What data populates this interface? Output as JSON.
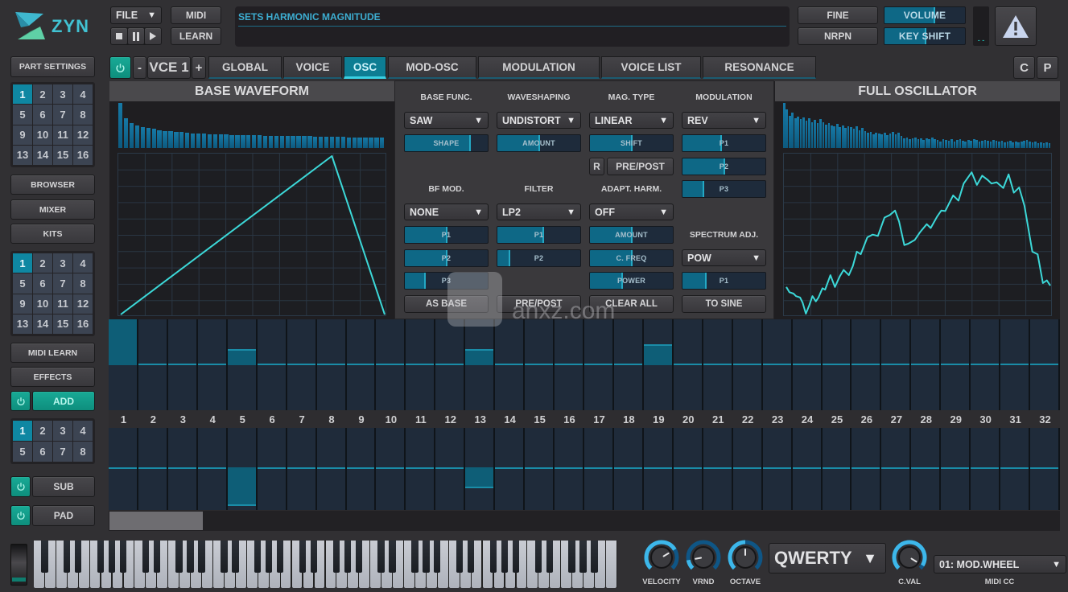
{
  "logo": {
    "text": "ZYN"
  },
  "header": {
    "file_label": "FILE",
    "midi_label": "MIDI",
    "learn_label": "LEARN",
    "status_text": "SETS HARMONIC MAGNITUDE",
    "fine_label": "FINE",
    "nrpn_label": "NRPN",
    "volume": {
      "label": "VOLUME",
      "value": 0.63
    },
    "key_shift": {
      "label": "KEY SHIFT",
      "value": 0.52
    },
    "meter_text": "- -"
  },
  "sidebar": {
    "part_settings_label": "PART SETTINGS",
    "part_grid": {
      "cells": [
        "1",
        "2",
        "3",
        "4",
        "5",
        "6",
        "7",
        "8",
        "9",
        "10",
        "11",
        "12",
        "13",
        "14",
        "15",
        "16"
      ],
      "active_index": 0
    },
    "browser_label": "BROWSER",
    "mixer_label": "MIXER",
    "kits_label": "KITS",
    "kit_grid": {
      "cells": [
        "1",
        "2",
        "3",
        "4",
        "5",
        "6",
        "7",
        "8",
        "9",
        "10",
        "11",
        "12",
        "13",
        "14",
        "15",
        "16"
      ],
      "active_index": 0
    },
    "midi_learn_label": "MIDI LEARN",
    "effects_label": "EFFECTS",
    "add_label": "ADD",
    "voice_grid": {
      "cells": [
        "1",
        "2",
        "3",
        "4",
        "5",
        "6",
        "7",
        "8"
      ],
      "active_index": 0
    },
    "sub_label": "SUB",
    "pad_label": "PAD"
  },
  "voice_selector": {
    "minus": "-",
    "label": "VCE 1",
    "plus": "+"
  },
  "tabs": {
    "active_index": 2,
    "items": [
      {
        "label": "GLOBAL"
      },
      {
        "label": "VOICE"
      },
      {
        "label": "OSC"
      },
      {
        "label": "MOD-OSC"
      },
      {
        "label": "MODULATION"
      },
      {
        "label": "VOICE LIST"
      },
      {
        "label": "RESONANCE"
      }
    ]
  },
  "corner_buttons": {
    "c": "C",
    "p": "P"
  },
  "base_waveform": {
    "title": "BASE WAVEFORM",
    "spectrum": [
      1.0,
      0.66,
      0.56,
      0.5,
      0.47,
      0.44,
      0.42,
      0.4,
      0.38,
      0.37,
      0.36,
      0.35,
      0.34,
      0.33,
      0.32,
      0.32,
      0.31,
      0.31,
      0.3,
      0.3,
      0.29,
      0.29,
      0.29,
      0.28,
      0.28,
      0.28,
      0.27,
      0.27,
      0.27,
      0.27,
      0.26,
      0.26,
      0.26,
      0.26,
      0.26,
      0.25,
      0.25,
      0.25,
      0.25,
      0.25,
      0.25,
      0.24,
      0.24,
      0.24,
      0.24,
      0.24,
      0.24,
      0.24
    ],
    "points": [
      [
        0,
        -1
      ],
      [
        0.8,
        1
      ],
      [
        1,
        -1
      ]
    ]
  },
  "full_oscillator": {
    "title": "FULL OSCILLATOR",
    "spectrum": [
      1.0,
      0.86,
      0.72,
      0.78,
      0.66,
      0.7,
      0.64,
      0.68,
      0.6,
      0.66,
      0.58,
      0.62,
      0.56,
      0.64,
      0.58,
      0.52,
      0.56,
      0.5,
      0.48,
      0.54,
      0.46,
      0.5,
      0.44,
      0.48,
      0.46,
      0.42,
      0.48,
      0.4,
      0.44,
      0.38,
      0.34,
      0.36,
      0.3,
      0.34,
      0.32,
      0.3,
      0.34,
      0.28,
      0.32,
      0.36,
      0.3,
      0.34,
      0.26,
      0.22,
      0.24,
      0.2,
      0.22,
      0.24,
      0.2,
      0.22,
      0.18,
      0.22,
      0.2,
      0.24,
      0.2,
      0.18,
      0.14,
      0.2,
      0.18,
      0.16,
      0.2,
      0.14,
      0.18,
      0.2,
      0.16,
      0.14,
      0.18,
      0.16,
      0.2,
      0.18,
      0.14,
      0.16,
      0.18,
      0.16,
      0.14,
      0.18,
      0.16,
      0.14,
      0.16,
      0.12,
      0.14,
      0.16,
      0.12,
      0.14,
      0.12,
      0.14,
      0.16,
      0.18,
      0.14,
      0.12,
      0.14,
      0.1,
      0.12,
      0.1,
      0.12,
      0.1
    ],
    "points": [
      [
        0,
        -0.653
      ],
      [
        0.012,
        -0.719
      ],
      [
        0.027,
        -0.736
      ],
      [
        0.037,
        -0.769
      ],
      [
        0.052,
        -0.785
      ],
      [
        0.062,
        -0.851
      ],
      [
        0.074,
        -0.99
      ],
      [
        0.087,
        -0.884
      ],
      [
        0.099,
        -0.769
      ],
      [
        0.112,
        -0.835
      ],
      [
        0.122,
        -0.785
      ],
      [
        0.137,
        -0.669
      ],
      [
        0.147,
        -0.686
      ],
      [
        0.167,
        -0.504
      ],
      [
        0.184,
        -0.653
      ],
      [
        0.202,
        -0.521
      ],
      [
        0.217,
        -0.438
      ],
      [
        0.237,
        -0.504
      ],
      [
        0.252,
        -0.388
      ],
      [
        0.267,
        -0.207
      ],
      [
        0.282,
        -0.24
      ],
      [
        0.307,
        -0.025
      ],
      [
        0.327,
        0.008
      ],
      [
        0.347,
        -0.008
      ],
      [
        0.372,
        0.223
      ],
      [
        0.392,
        0.256
      ],
      [
        0.412,
        0.312
      ],
      [
        0.427,
        0.174
      ],
      [
        0.447,
        -0.124
      ],
      [
        0.462,
        -0.107
      ],
      [
        0.487,
        -0.058
      ],
      [
        0.507,
        0.041
      ],
      [
        0.532,
        0.14
      ],
      [
        0.547,
        0.091
      ],
      [
        0.572,
        0.24
      ],
      [
        0.587,
        0.312
      ],
      [
        0.602,
        0.306
      ],
      [
        0.632,
        0.504
      ],
      [
        0.652,
        0.438
      ],
      [
        0.672,
        0.653
      ],
      [
        0.702,
        0.795
      ],
      [
        0.722,
        0.636
      ],
      [
        0.742,
        0.752
      ],
      [
        0.762,
        0.702
      ],
      [
        0.777,
        0.653
      ],
      [
        0.797,
        0.669
      ],
      [
        0.822,
        0.597
      ],
      [
        0.842,
        0.769
      ],
      [
        0.862,
        0.537
      ],
      [
        0.882,
        0.603
      ],
      [
        0.902,
        0.372
      ],
      [
        0.932,
        -0.207
      ],
      [
        0.952,
        -0.24
      ],
      [
        0.972,
        -0.603
      ],
      [
        0.987,
        -0.57
      ],
      [
        1.0,
        -0.636
      ]
    ]
  },
  "osc_controls": {
    "base_func": {
      "label": "BASE FUNC.",
      "selected": "SAW",
      "shape": {
        "label": "SHAPE",
        "value": 0.8
      }
    },
    "waveshaping": {
      "label": "WAVESHAPING",
      "selected": "UNDISTORT",
      "amount": {
        "label": "AMOUNT",
        "value": 0.51
      }
    },
    "mag_type": {
      "label": "MAG. TYPE",
      "selected": "LINEAR",
      "shift": {
        "label": "SHIFT",
        "value": 0.51
      },
      "r_label": "R",
      "prepost_label": "PRE/POST"
    },
    "modulation": {
      "label": "MODULATION",
      "selected": "REV",
      "p1": {
        "label": "P1",
        "value": 0.48
      },
      "p2": {
        "label": "P2",
        "value": 0.51
      },
      "p3": {
        "label": "P3",
        "value": 0.26
      }
    },
    "bf_mod": {
      "label": "BF MOD.",
      "selected": "NONE",
      "p1": {
        "label": "P1",
        "value": 0.51
      },
      "p2": {
        "label": "P2",
        "value": 0.51
      },
      "p3": {
        "label": "P3",
        "value": 0.25
      },
      "as_base_label": "AS BASE"
    },
    "filter": {
      "label": "FILTER",
      "selected": "LP2",
      "p1": {
        "label": "P1",
        "value": 0.56
      },
      "p2": {
        "label": "P2",
        "value": 0.16
      },
      "prepost_label": "PRE/POST"
    },
    "adapt_harm": {
      "label": "ADAPT. HARM.",
      "selected": "OFF",
      "amount": {
        "label": "AMOUNT",
        "value": 0.51
      },
      "c_freq": {
        "label": "C. FREQ",
        "value": 0.51
      },
      "power": {
        "label": "POWER",
        "value": 0.4
      },
      "clear_all_label": "CLEAR ALL"
    },
    "spectrum_adj": {
      "label": "SPECTRUM ADJ.",
      "selected": "POW",
      "p1": {
        "label": "P1",
        "value": 0.29
      },
      "to_sine_label": "TO SINE"
    }
  },
  "harmonics": {
    "labels": [
      "1",
      "2",
      "3",
      "4",
      "5",
      "6",
      "7",
      "8",
      "9",
      "10",
      "11",
      "12",
      "13",
      "14",
      "15",
      "16",
      "17",
      "18",
      "19",
      "20",
      "21",
      "22",
      "23",
      "24",
      "25",
      "26",
      "27",
      "28",
      "29",
      "30",
      "31",
      "32"
    ],
    "magnitudes": [
      1.0,
      0,
      0,
      0,
      0.34,
      0,
      0,
      0,
      0,
      0,
      0,
      0,
      0.34,
      0,
      0,
      0,
      0,
      0,
      0.45,
      0,
      0,
      0,
      0,
      0,
      0,
      0,
      0,
      0,
      0,
      0,
      0,
      0
    ],
    "phases": [
      0,
      0,
      0,
      0,
      -0.9,
      0,
      0,
      0,
      0,
      0,
      0,
      0,
      -0.49,
      0,
      0,
      0,
      0,
      0,
      0,
      0,
      0,
      0,
      0,
      0,
      0,
      0,
      0,
      0,
      0,
      0,
      0,
      0
    ]
  },
  "keyboard": {
    "white_keys": 52,
    "first_key": "A"
  },
  "bottom": {
    "velocity": {
      "label": "VELOCITY",
      "value": 0.72
    },
    "vrnd": {
      "label": "VRND",
      "value": 0.13
    },
    "octave": {
      "label": "OCTAVE",
      "value": 0.5
    },
    "layout_select": {
      "selected": "QWERTY"
    },
    "c_val": {
      "label": "C.VAL",
      "value": 0.95
    },
    "midi_cc": {
      "label": "MIDI CC",
      "selected": "01: MOD.WHEEL"
    }
  },
  "watermark": {
    "text": "anxz.com"
  }
}
